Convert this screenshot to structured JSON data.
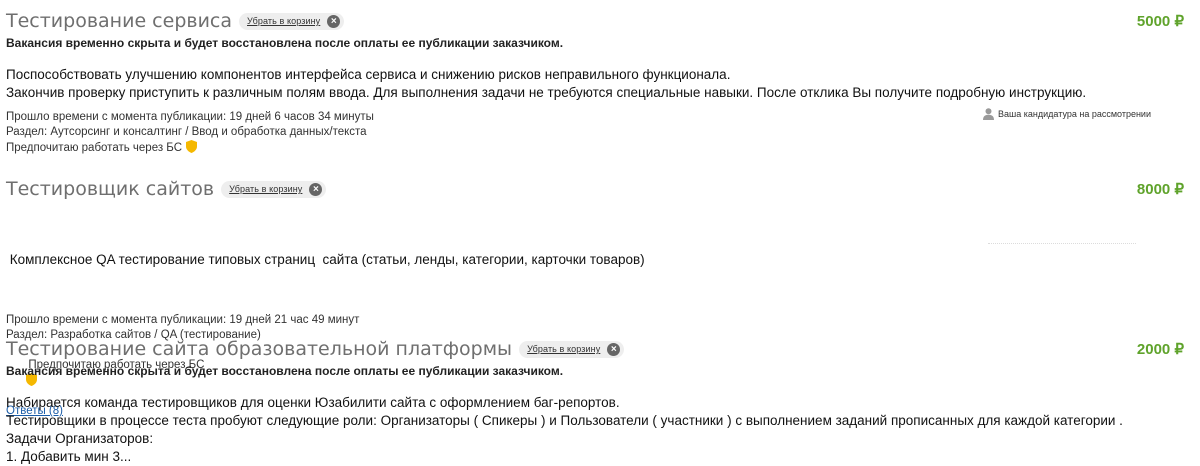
{
  "jobs": [
    {
      "title": "Тестирование сервиса",
      "remove_label": "Убрать в корзину",
      "price": "5000 ₽",
      "notice": "Вакансия временно скрыта и будет восстановлена после оплаты ее публикации заказчиком.",
      "description": [
        "Поспособствовать улучшению компонентов интерфейса сервиса и снижению рисков неправильного функционала.",
        "Закончив проверку приступить к различным полям ввода. Для выполнения задачи не требуются специальные навыки. После отклика Вы получите подробную инструкцию."
      ],
      "elapsed": "Прошло времени с момента публикации: 19 дней 6 часов 34 минуты",
      "section": "Раздел: Аутсорсинг и консалтинг / Ввод и обработка данных/текста",
      "preference": "Предпочитаю работать через БС",
      "status": "Ваша кандидатура на рассмотрении"
    },
    {
      "title": "Тестировщик сайтов",
      "remove_label": "Убрать в корзину",
      "price": "8000 ₽",
      "description": [
        " Комплексное QA тестирование типовых страниц  сайта (статьи, ленды, категории, карточки товаров)"
      ],
      "elapsed": "Прошло времени с момента публикации: 19 дней 21 час 49 минут",
      "section": "Раздел: Разработка сайтов / QA (тестирование)",
      "preference": " Предпочитаю работать через БС",
      "answers": "Ответы (8)"
    },
    {
      "title": "Тестирование сайта образовательной платформы",
      "remove_label": "Убрать в корзину",
      "price": "2000 ₽",
      "notice": "Вакансия временно скрыта и будет восстановлена после оплаты ее публикации заказчиком.",
      "description": [
        "Набирается команда тестировщиков для оценки Юзабилити сайта с оформлением баг-репортов.",
        "Тестировщики в процессе теста пробуют следующие роли: Организаторы ( Спикеры ) и Пользователи ( участники ) с выполнением заданий прописанных для каждой категории .",
        "Задачи Организаторов:",
        "1. Добавить мин 3..."
      ]
    }
  ],
  "colors": {
    "price": "#5fa32b",
    "title": "#6f6f6f",
    "link": "#1a5ca8",
    "shield": "#f5b800"
  }
}
